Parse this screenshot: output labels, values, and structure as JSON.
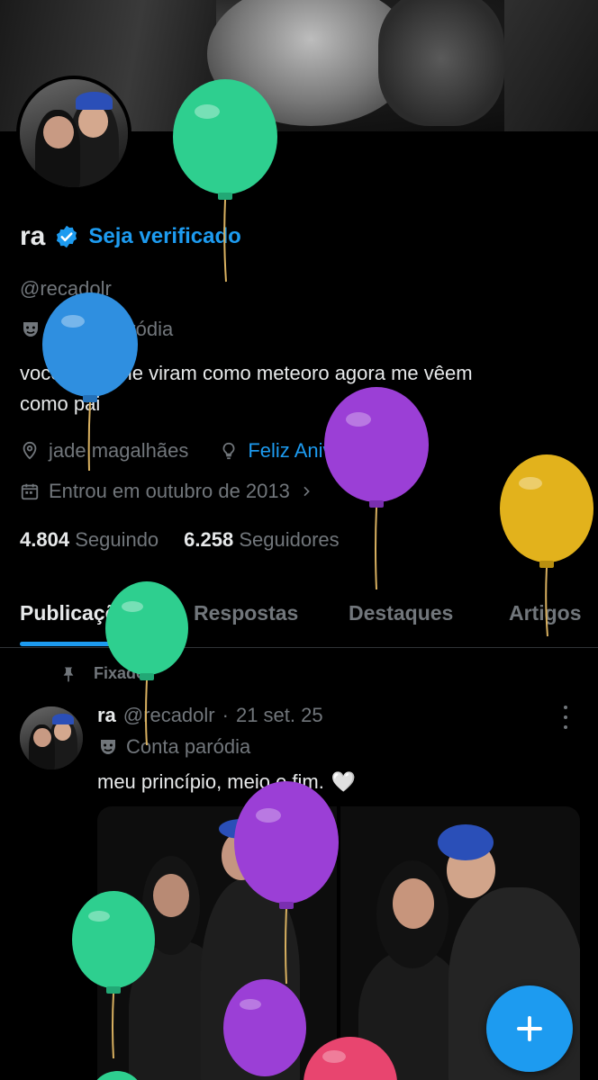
{
  "profile": {
    "name": "ra",
    "get_verified": "Seja verificado",
    "handle": "@recadolr",
    "parody_label": "Conta paródia",
    "bio_line1": "vocês que me viram como meteoro agora me vêem",
    "bio_line2": "como pai",
    "location": "jade magalhães",
    "website": "Feliz Aniversário!",
    "joined": "Entrou em outubro de 2013",
    "following_count": "4.804",
    "following_label": "Seguindo",
    "followers_count": "6.258",
    "followers_label": "Seguidores"
  },
  "tabs": [
    {
      "label": "Publicações",
      "active": true
    },
    {
      "label": "Respostas",
      "active": false
    },
    {
      "label": "Destaques",
      "active": false
    },
    {
      "label": "Artigos",
      "active": false
    }
  ],
  "post": {
    "pinned_label": "Fixado",
    "author_name": "ra",
    "author_handle": "@recadolr",
    "dot": "·",
    "date": "21 set. 25",
    "parody_label": "Conta paródia",
    "text": "meu princípio, meio e fim.",
    "emoji": "🤍"
  },
  "colors": {
    "accent": "#1d9bf0",
    "background": "#000000",
    "text_primary": "#e7e9ea",
    "text_secondary": "#71767b",
    "balloon_green": "#2ecf8f",
    "balloon_blue": "#2f8fe0",
    "balloon_purple": "#9b3fd6",
    "balloon_yellow": "#e2b21c",
    "balloon_pink": "#e8456f"
  },
  "icons": {
    "verified": "verified-badge-icon",
    "parody": "theater-mask-icon",
    "location": "location-pin-icon",
    "website": "lightbulb-icon",
    "calendar": "calendar-icon",
    "pin": "pin-icon",
    "more": "more-vertical-icon",
    "compose": "plus-icon"
  }
}
